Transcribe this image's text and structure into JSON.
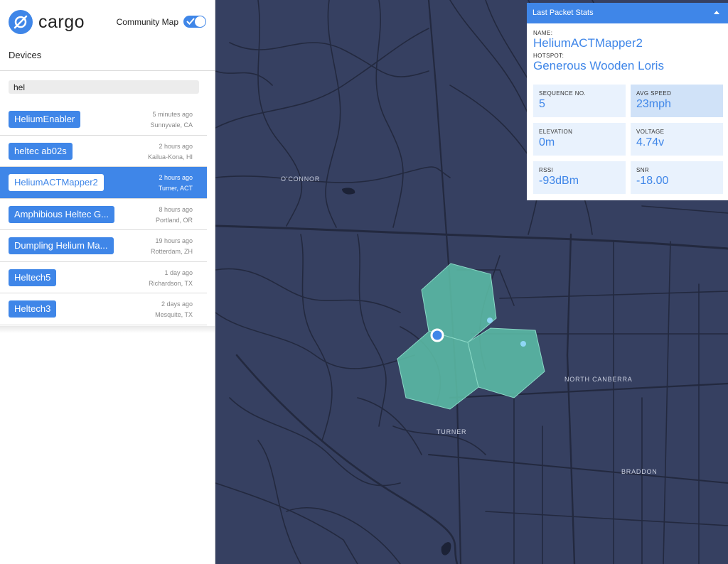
{
  "app": {
    "name": "cargo"
  },
  "community": {
    "label": "Community Map",
    "enabled": true
  },
  "devices_title": "Devices",
  "search": {
    "value": "hel",
    "placeholder": ""
  },
  "devices": [
    {
      "name": "HeliumEnabler",
      "time": "5 minutes ago",
      "location": "Sunnyvale, CA",
      "selected": false
    },
    {
      "name": "heltec ab02s",
      "time": "2 hours ago",
      "location": "Kailua-Kona, HI",
      "selected": false
    },
    {
      "name": "HeliumACTMapper2",
      "time": "2 hours ago",
      "location": "Turner, ACT",
      "selected": true
    },
    {
      "name": "Amphibious Heltec G...",
      "time": "8 hours ago",
      "location": "Portland, OR",
      "selected": false
    },
    {
      "name": "Dumpling Helium Ma...",
      "time": "19 hours ago",
      "location": "Rotterdam, ZH",
      "selected": false
    },
    {
      "name": "Heltech5",
      "time": "1 day ago",
      "location": "Richardson, TX",
      "selected": false
    },
    {
      "name": "Heltech3",
      "time": "2 days ago",
      "location": "Mesquite, TX",
      "selected": false
    }
  ],
  "map_labels": {
    "oconnor": "O'CONNOR",
    "north_canberra": "NORTH CANBERRA",
    "turner": "TURNER",
    "braddon": "BRADDON"
  },
  "stats": {
    "title": "Last Packet Stats",
    "name_label": "NAME:",
    "name": "HeliumACTMapper2",
    "hotspot_label": "HOTSPOT:",
    "hotspot": "Generous Wooden Loris",
    "sequence_label": "SEQUENCE NO.",
    "sequence": "5",
    "speed_label": "AVG SPEED",
    "speed": "23mph",
    "elevation_label": "ELEVATION",
    "elevation": "0m",
    "voltage_label": "VOLTAGE",
    "voltage": "4.74v",
    "rssi_label": "RSSI",
    "rssi": "-93dBm",
    "snr_label": "SNR",
    "snr": "-18.00"
  },
  "colors": {
    "accent": "#3f86e8",
    "map_bg": "#364061",
    "hex_fill": "#5bbca6"
  }
}
